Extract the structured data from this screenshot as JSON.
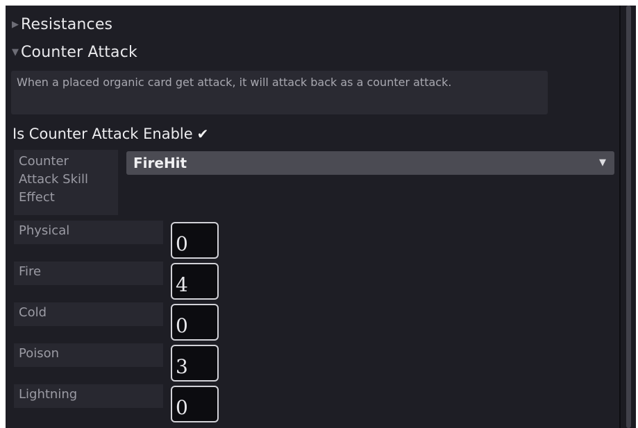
{
  "foldouts": {
    "resistances": {
      "label": "Resistances",
      "expanded": false,
      "arrow_glyph": "▶"
    },
    "counter_attack": {
      "label": "Counter Attack",
      "expanded": true,
      "arrow_glyph": "▼"
    }
  },
  "description": "When a placed organic card get attack, it will attack back as a counter attack.",
  "toggle": {
    "label": "Is Counter Attack Enable",
    "checked": true,
    "check_glyph": "✔"
  },
  "skill_effect": {
    "label_lines": [
      "Counter",
      "Attack Skill",
      "Effect"
    ],
    "selected": "FireHit",
    "arrow_glyph": "▼"
  },
  "damage_fields": [
    {
      "label": "Physical",
      "value": "0"
    },
    {
      "label": "Fire",
      "value": "4"
    },
    {
      "label": "Cold",
      "value": "0"
    },
    {
      "label": "Poison",
      "value": "3"
    },
    {
      "label": "Lightning",
      "value": "0"
    }
  ],
  "colors": {
    "panel_bg": "#1e1e25",
    "label_bg": "#282830",
    "dropdown_bg": "#4b4b53",
    "field_bg": "#0c0c10",
    "field_border": "#d2d2d8",
    "text_primary": "#e9e9ec",
    "text_secondary": "#9b9ba4"
  }
}
